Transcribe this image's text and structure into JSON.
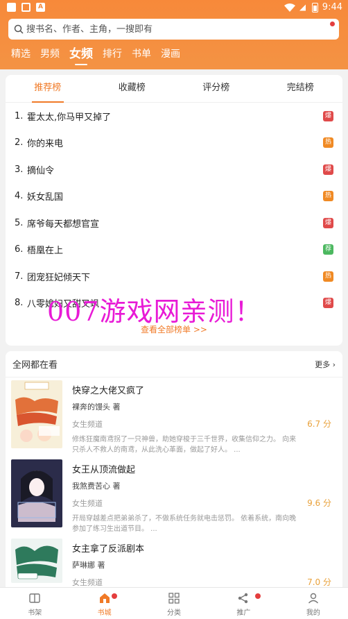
{
  "status_bar": {
    "time": "9:44"
  },
  "search": {
    "placeholder": "搜书名、作者、主角，一搜即有"
  },
  "channel_tabs": [
    "精选",
    "男频",
    "女频",
    "排行",
    "书单",
    "漫画"
  ],
  "active_channel": "女频",
  "ranking": {
    "tabs": [
      "推荐榜",
      "收藏榜",
      "评分榜",
      "完结榜"
    ],
    "active_tab": "推荐榜",
    "items": [
      {
        "rank": "1.",
        "title": "霍太太,你马甲又掉了",
        "badge": "爆",
        "badge_color": "#e04a4a"
      },
      {
        "rank": "2.",
        "title": "你的来电",
        "badge": "热",
        "badge_color": "#f08a24"
      },
      {
        "rank": "3.",
        "title": "摘仙令",
        "badge": "爆",
        "badge_color": "#e04a4a"
      },
      {
        "rank": "4.",
        "title": "妖女乱国",
        "badge": "热",
        "badge_color": "#f08a24"
      },
      {
        "rank": "5.",
        "title": "席爷每天都想官宣",
        "badge": "爆",
        "badge_color": "#e04a4a"
      },
      {
        "rank": "6.",
        "title": "梧凰在上",
        "badge": "荐",
        "badge_color": "#4cb860"
      },
      {
        "rank": "7.",
        "title": "团宠狂妃倾天下",
        "badge": "热",
        "badge_color": "#f08a24"
      },
      {
        "rank": "8.",
        "title": "八零媳妇又甜又飒",
        "badge": "爆",
        "badge_color": "#e04a4a"
      }
    ],
    "view_all": "查看全部榜单 >>"
  },
  "watermark": "007游戏网亲测！",
  "everyone": {
    "title": "全网都在看",
    "more": "更多",
    "books": [
      {
        "title": "快穿之大佬又疯了",
        "author": "裸奔的馒头 著",
        "channel": "女生频道",
        "score": "6.7 分",
        "desc": "修炼狂魔南鸢拐了一只神兽，助她穿梭于三千世界，收集信仰之力。 向来只杀人不救人的南鸢，从此洗心革面，做起了好人。 ..."
      },
      {
        "title": "女王从顶流做起",
        "author": "我煞费苦心 著",
        "channel": "女生频道",
        "score": "9.6 分",
        "desc": "开局穿越差点把弟弟杀了，不做系统任务就电击惩罚。 依着系统，南向晚参加了练习生出道节目。 ..."
      },
      {
        "title": "女主拿了反派剧本",
        "author": "萨琳娜 著",
        "channel": "女生频道",
        "score": "7.0 分",
        "desc": ""
      }
    ]
  },
  "bottom_nav": [
    "书架",
    "书城",
    "分类",
    "推广",
    "我的"
  ],
  "active_nav": "书城"
}
